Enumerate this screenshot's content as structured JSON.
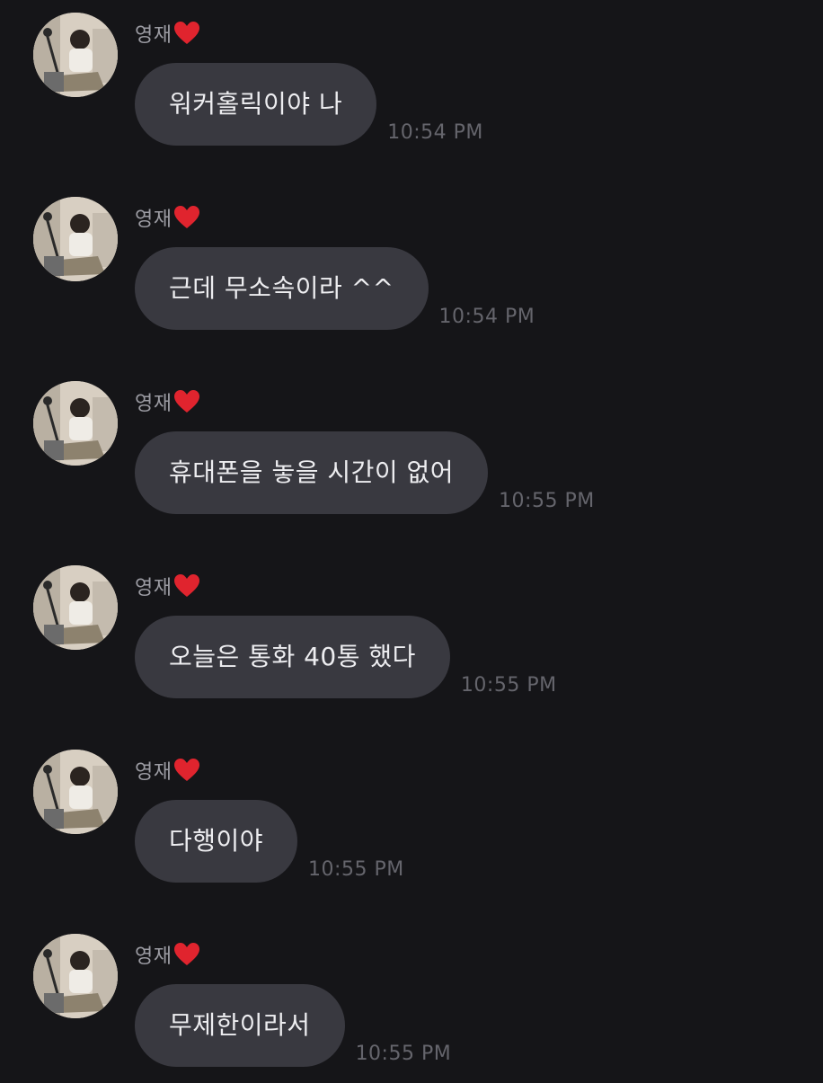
{
  "messages": [
    {
      "sender": "영재",
      "text": "워커홀릭이야 나",
      "time": "10:54 PM"
    },
    {
      "sender": "영재",
      "text": "근데 무소속이라 ^^",
      "time": "10:54 PM"
    },
    {
      "sender": "영재",
      "text": "휴대폰을 놓을 시간이 없어",
      "time": "10:55 PM"
    },
    {
      "sender": "영재",
      "text": "오늘은 통화 40통 했다",
      "time": "10:55 PM"
    },
    {
      "sender": "영재",
      "text": "다행이야",
      "time": "10:55 PM"
    },
    {
      "sender": "영재",
      "text": "무제한이라서",
      "time": "10:55 PM"
    }
  ],
  "icons": {
    "sender_badge": "red-heart-icon",
    "avatar": "profile-photo"
  },
  "colors": {
    "background": "#151518",
    "bubble": "#393940",
    "heart": "#e0242e",
    "timestamp": "#65656c"
  }
}
